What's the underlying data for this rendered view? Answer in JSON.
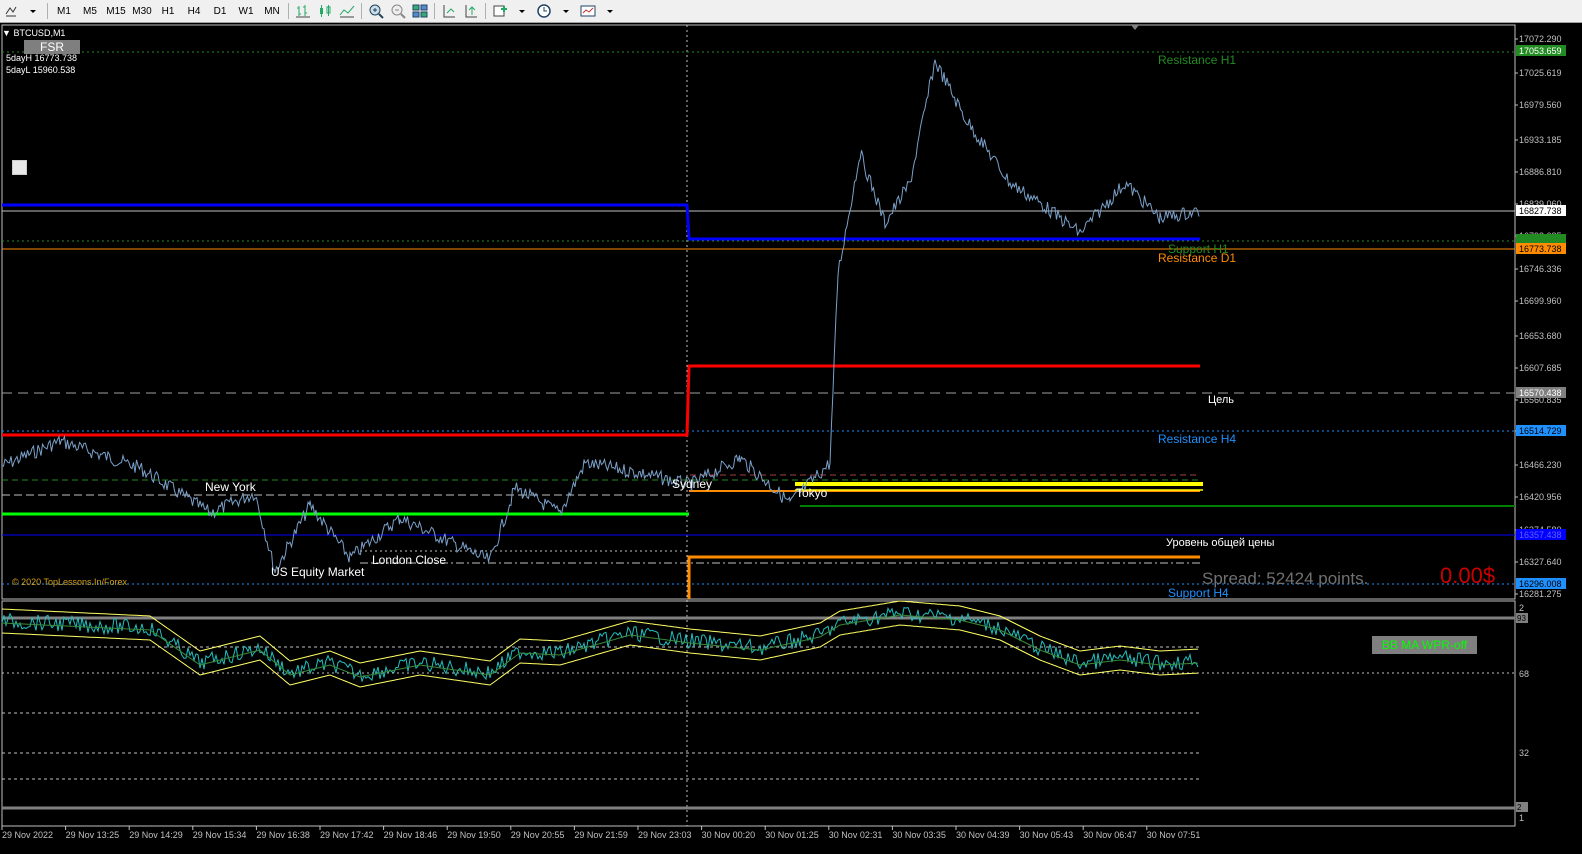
{
  "toolbar": {
    "timeframes": [
      "M1",
      "M5",
      "M15",
      "M30",
      "H1",
      "H4",
      "D1",
      "W1",
      "MN"
    ]
  },
  "chart": {
    "symbol": "BTCUSD,M1",
    "fsr_button": "FSR",
    "five_day_high": "5dayH 16773.738",
    "five_day_low": "5dayL 15960.538",
    "copyright": "© 2020 TopLessons.In/Forex",
    "sessions": {
      "new_york": "New York",
      "us_equity": "US Equity Market",
      "london_close": "London Close",
      "sydney": "Sydney",
      "tokyo": "Tokyo"
    },
    "levels": {
      "resistance_h1": "Resistance H1",
      "support_h1": "Support H1",
      "resistance_d1": "Resistance D1",
      "target": "Цель",
      "resistance_h4": "Resistance H4",
      "common_price": "Уровень общей цены",
      "support_h4": "Support H4"
    },
    "spread": "Spread: 52424 points.",
    "profit": "0.00$",
    "price_axis": [
      "17072.290",
      "17025.619",
      "16979.560",
      "16933.185",
      "16886.810",
      "16839.060",
      "16793.685",
      "16746.336",
      "16699.960",
      "16653.680",
      "16607.685",
      "16560.835",
      "16514.729",
      "16466.230",
      "16420.956",
      "16374.580",
      "16327.640",
      "16281.275"
    ],
    "price_tags": {
      "resistance_h1": "17053.659",
      "current": "16827.738",
      "support_d1": "16773.738",
      "target": "16570.438",
      "resistance_h4": "16514.729",
      "common": "16357.438",
      "support_h4": "16296.008"
    },
    "time_axis": [
      "29 Nov 2022",
      "29 Nov 13:25",
      "29 Nov 14:29",
      "29 Nov 15:34",
      "29 Nov 16:38",
      "29 Nov 17:42",
      "29 Nov 18:46",
      "29 Nov 19:50",
      "29 Nov 20:55",
      "29 Nov 21:59",
      "29 Nov 23:03",
      "30 Nov 00:20",
      "30 Nov 01:25",
      "30 Nov 02:31",
      "30 Nov 03:35",
      "30 Nov 04:39",
      "30 Nov 05:43",
      "30 Nov 06:47",
      "30 Nov 07:51"
    ]
  },
  "indicator": {
    "button": "BB MA WPR-off",
    "axis": [
      "2",
      "93",
      "68",
      "32",
      "2",
      "1"
    ]
  },
  "colors": {
    "background": "#000000",
    "price_line": "#7aa0c8",
    "resistance": "#ff0000",
    "support_blue": "#0000ff",
    "green": "#00ff00",
    "orange": "#ff8c00",
    "yellow": "#ffff00",
    "resistance_h1_text": "#228b22",
    "resistance_h4_text": "#1e90ff",
    "spread_text": "#707070",
    "profit_text": "#cc0000"
  }
}
